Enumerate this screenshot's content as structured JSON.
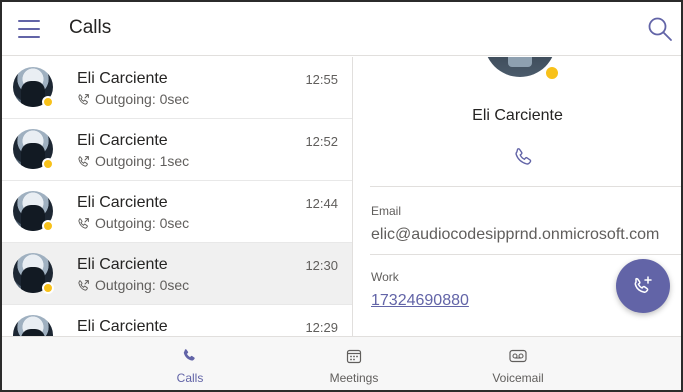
{
  "header": {
    "title": "Calls"
  },
  "calls": [
    {
      "name": "Eli Carciente",
      "time": "12:55",
      "detail": "Outgoing: 0sec"
    },
    {
      "name": "Eli Carciente",
      "time": "12:52",
      "detail": "Outgoing: 1sec"
    },
    {
      "name": "Eli Carciente",
      "time": "12:44",
      "detail": "Outgoing: 0sec"
    },
    {
      "name": "Eli Carciente",
      "time": "12:30",
      "detail": "Outgoing: 0sec"
    },
    {
      "name": "Eli Carciente",
      "time": "12:29",
      "detail": ""
    }
  ],
  "contact": {
    "name": "Eli Carciente",
    "email_label": "Email",
    "email": "elic@audiocodesipprnd.onmicrosoft.com",
    "work_label": "Work",
    "work_number": "17324690880"
  },
  "tabs": [
    {
      "label": "Calls",
      "icon": "phone-icon",
      "active": true
    },
    {
      "label": "Meetings",
      "icon": "calendar-icon",
      "active": false
    },
    {
      "label": "Voicemail",
      "icon": "voicemail-icon",
      "active": false
    }
  ],
  "colors": {
    "accent": "#6264a7",
    "presence": "#f8c11a"
  }
}
